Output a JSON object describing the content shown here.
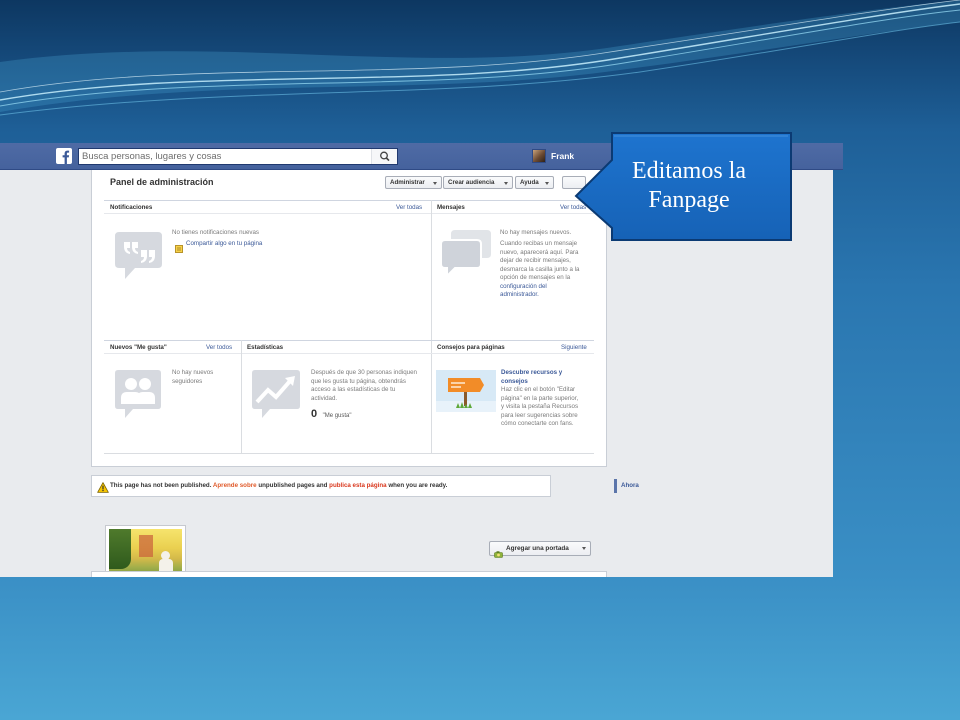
{
  "slide": {
    "callout": {
      "line1": "Editamos la",
      "line2": "Fanpage"
    },
    "colors": {
      "callout_fill": "#1a6bc5",
      "callout_border": "#0b3a73",
      "background_top": "#0d3761",
      "background_bottom": "#4aa6d4",
      "wave_lines": "#bfe8f7"
    }
  },
  "facebook": {
    "colors": {
      "header": "#4b67a1",
      "link": "#3b5998",
      "notice_link": "#e05a2a",
      "page_bg": "#e9ebee"
    },
    "header": {
      "logo_icon": "facebook-f-icon",
      "search_placeholder": "Busca personas, lugares y cosas",
      "search_icon": "magnifier-icon",
      "user_name": "Frank"
    },
    "admin_panel": {
      "title": "Panel de administración",
      "menu_buttons": [
        {
          "label": "Administrar",
          "icon": "caret-down-icon"
        },
        {
          "label": "Crear audiencia",
          "icon": "caret-down-icon"
        },
        {
          "label": "Ayuda",
          "icon": "caret-down-icon"
        }
      ],
      "notifications": {
        "header": "Notificaciones",
        "link": "Ver todas",
        "icon": "quote-bubble-icon",
        "empty_text": "No tienes notificaciones nuevas",
        "share_icon": "note-icon",
        "share_link": "Compartir algo en tu página"
      },
      "messages": {
        "header": "Mensajes",
        "link": "Ver todas",
        "icon": "chat-bubbles-icon",
        "text_lines": [
          "No hay mensajes nuevos.",
          "Cuando recibas un mensaje",
          "nuevo, aparecerá aquí. Para",
          "dejar de recibir mensajes,",
          "desmarca la casilla junto a la",
          "opción de mensajes en la"
        ],
        "link_lines": [
          "configuración del",
          "administrador."
        ]
      },
      "new_likes": {
        "header": "Nuevos \"Me gusta\"",
        "link": "Ver todos",
        "icon": "people-icon",
        "text_lines": [
          "No hay nuevos",
          "seguidores"
        ]
      },
      "stats": {
        "header": "Estadísticas",
        "icon": "line-chart-icon",
        "text_lines": [
          "Después de que 30 personas indiquen",
          "que les gusta tu página, obtendrás",
          "acceso a las estadísticas de tu",
          "actividad."
        ],
        "count": "0",
        "count_label": "\"Me gusta\""
      },
      "tips": {
        "header": "Consejos para páginas",
        "link": "Siguiente",
        "image_icon": "flag-sign-icon",
        "title_lines": [
          "Descubre recursos y",
          "consejos"
        ],
        "text_lines": [
          "Haz clic en el botón \"Editar",
          "página\" en la parte superior,",
          "y visita la pestaña Recursos",
          "para leer sugerencias sobre",
          "cómo conectarte con fans."
        ]
      }
    },
    "notice": {
      "icon": "warning-icon",
      "text1": "This page has not been published.",
      "link1": "Aprende sobre",
      "text2": "unpublished pages and",
      "link2": "publica esta página",
      "text3": "when you are ready."
    },
    "timeline": {
      "current": "Ahora"
    },
    "cover": {
      "add_cover_label": "Agregar una portada",
      "add_cover_icon": "camera-icon",
      "caret_icon": "caret-down-icon"
    }
  }
}
